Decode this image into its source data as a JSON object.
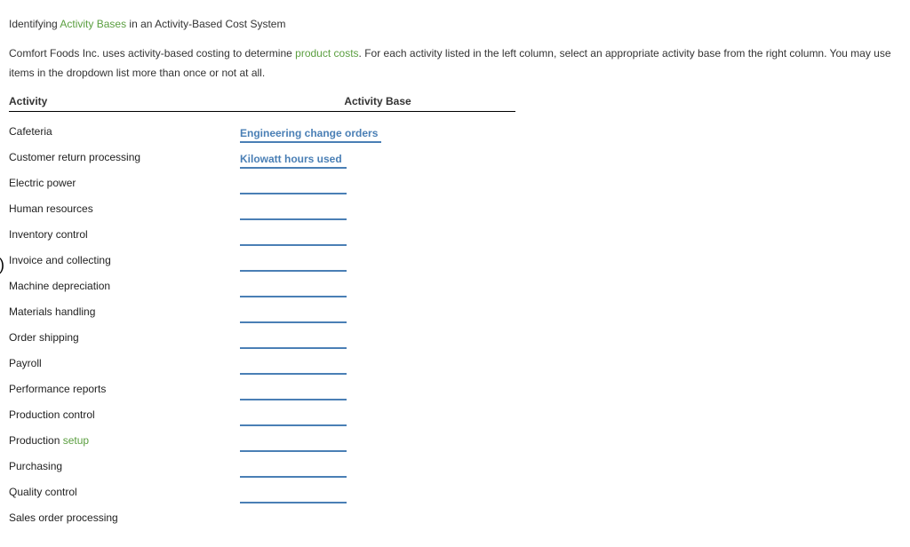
{
  "title": {
    "prefix": "Identifying ",
    "link": "Activity Bases",
    "suffix": " in an Activity-Based Cost System"
  },
  "instructions": {
    "part1": "Comfort Foods Inc. uses activity-based costing to determine ",
    "link": "product costs",
    "part2": ". For each activity listed in the left column, select an appropriate activity base from the right column. You may use items in the dropdown list more than once or not at all."
  },
  "headers": {
    "activity": "Activity",
    "base": "Activity Base"
  },
  "rows": [
    {
      "activity": "Cafeteria",
      "base": "Engineering change orders",
      "setup_link": false
    },
    {
      "activity": "Customer return processing",
      "base": "Kilowatt hours used",
      "setup_link": false
    },
    {
      "activity": "Electric power",
      "base": "",
      "setup_link": false
    },
    {
      "activity": "Human resources",
      "base": "",
      "setup_link": false
    },
    {
      "activity": "Inventory control",
      "base": "",
      "setup_link": false
    },
    {
      "activity": "Invoice and collecting",
      "base": "",
      "setup_link": false
    },
    {
      "activity": "Machine depreciation",
      "base": "",
      "setup_link": false
    },
    {
      "activity": "Materials handling",
      "base": "",
      "setup_link": false
    },
    {
      "activity": "Order shipping",
      "base": "",
      "setup_link": false
    },
    {
      "activity": "Payroll",
      "base": "",
      "setup_link": false
    },
    {
      "activity": "Performance reports",
      "base": "",
      "setup_link": false
    },
    {
      "activity": "Production control",
      "base": "",
      "setup_link": false
    },
    {
      "activity": "Production ",
      "base": "",
      "setup_link": true,
      "setup_text": "setup"
    },
    {
      "activity": "Purchasing",
      "base": "",
      "setup_link": false
    },
    {
      "activity": "Quality control",
      "base": "",
      "setup_link": false
    },
    {
      "activity": "Sales order processing",
      "base": "",
      "setup_link": false,
      "no_underline": true
    }
  ],
  "bracket": ")"
}
